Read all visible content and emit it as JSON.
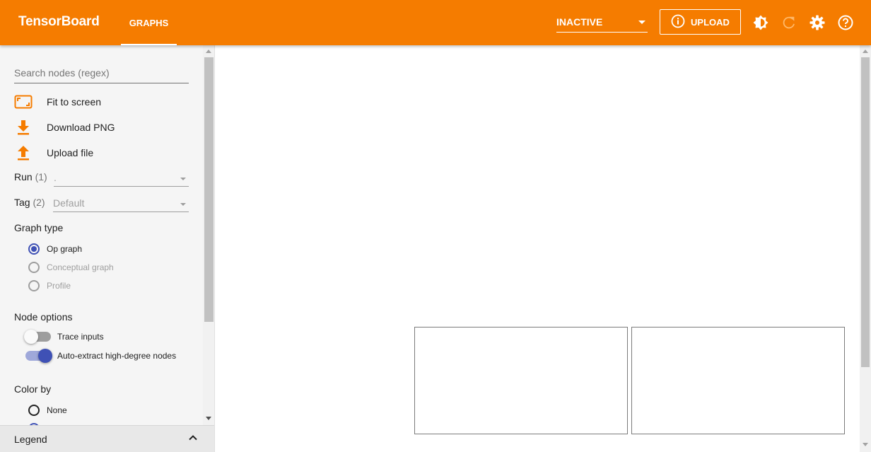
{
  "header": {
    "brand": "TensorBoard",
    "tab_label": "GRAPHS",
    "run_status": "INACTIVE",
    "upload_label": "UPLOAD",
    "bg_color": "#f57c00",
    "icons": [
      "info-icon",
      "brightness-icon",
      "refresh-icon",
      "settings-icon",
      "help-icon"
    ]
  },
  "sidebar": {
    "search_placeholder": "Search nodes (regex)",
    "actions": [
      {
        "label": "Fit to screen",
        "icon": "fit-screen-icon"
      },
      {
        "label": "Download PNG",
        "icon": "download-icon"
      },
      {
        "label": "Upload file",
        "icon": "upload-icon"
      }
    ],
    "run": {
      "label": "Run",
      "count": "(1)",
      "value": "."
    },
    "tag": {
      "label": "Tag",
      "count": "(2)",
      "value": "Default"
    },
    "graph_type": {
      "title": "Graph type",
      "options": [
        {
          "label": "Op graph",
          "checked": true
        },
        {
          "label": "Conceptual graph",
          "checked": false
        },
        {
          "label": "Profile",
          "checked": false
        }
      ]
    },
    "node_options": {
      "title": "Node options",
      "toggles": [
        {
          "label": "Trace inputs",
          "on": false
        },
        {
          "label": "Auto-extract high-degree nodes",
          "on": true
        }
      ]
    },
    "color_by": {
      "title": "Color by",
      "options": [
        {
          "label": "None",
          "checked": false
        }
      ]
    },
    "legend_label": "Legend",
    "accent_color": "#3f51b5",
    "icon_color": "#f57c00"
  }
}
